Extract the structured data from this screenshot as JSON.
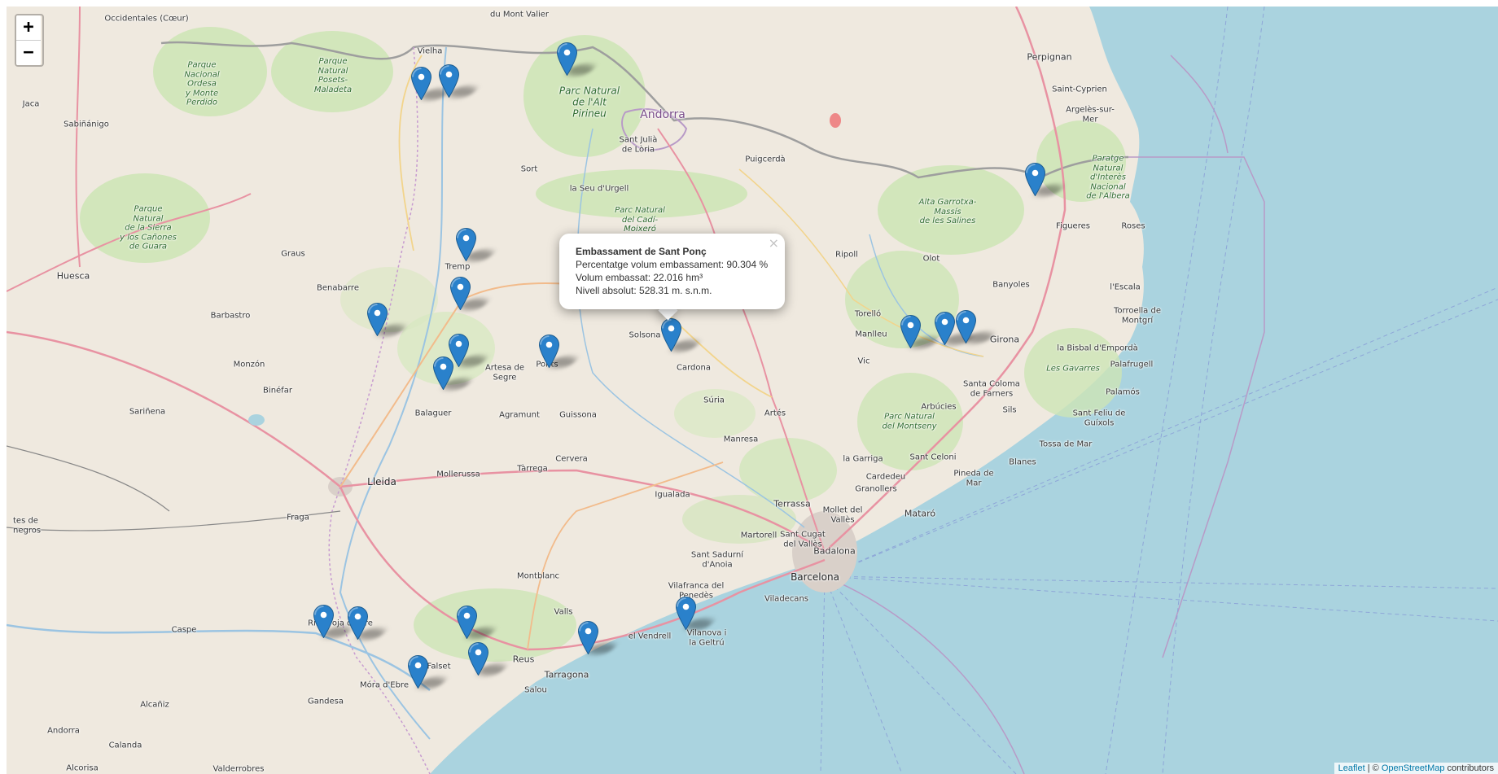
{
  "zoom": {
    "in_label": "+",
    "out_label": "−"
  },
  "popup": {
    "title": "Embassament de Sant Ponç",
    "line1": "Percentatge volum embassament: 90.304 %",
    "line2": "Volum embassat: 22.016 hm³",
    "line3": "Nivell absolut: 528.31 m. s.n.m.",
    "close": "×"
  },
  "attribution": {
    "leaflet": "Leaflet",
    "sep": " | © ",
    "osm": "OpenStreetMap",
    "rest": " contributors"
  },
  "marker_icon": "map-pin-icon",
  "colors": {
    "marker": "#2a81cb",
    "sea": "#aad3df",
    "land": "#efe9df",
    "park": "#cde5b5"
  },
  "places": {
    "vielha": "Vielha",
    "jaca": "Jaca",
    "sabinanigo": "Sabiñánigo",
    "andorra": "Andorra",
    "santjulia": "Sant Julià de Lòria",
    "sort": "Sort",
    "laseu": "la Seu d'Urgell",
    "puigcerda": "Puigcerdà",
    "perpignan": "Perpignan",
    "saintcyprien": "Saint-Cyprien",
    "argeles": "Argelès-sur-Mer",
    "figueres": "Figueres",
    "roses": "Roses",
    "olot": "Olot",
    "banyoles": "Banyoles",
    "lescala": "l'Escala",
    "girona": "Girona",
    "torroella": "Torroella de Montgrí",
    "labisbal": "la Bisbal d'Empordà",
    "palafrugell": "Palafrugell",
    "palamos": "Palamós",
    "santfeliu": "Sant Feliu de Guíxols",
    "tossa": "Tossa de Mar",
    "blanes": "Blanes",
    "pineda": "Pineda de Mar",
    "mataro": "Mataró",
    "badalona": "Badalona",
    "barcelona": "Barcelona",
    "terrassa": "Terrassa",
    "santcugat": "Sant Cugat del Vallès",
    "mollet": "Mollet del Vallès",
    "granollers": "Granollers",
    "cardedeu": "Cardedeu",
    "lagarriga": "la Garriga",
    "santceloni": "Sant Celoni",
    "arbucies": "Arbúcies",
    "santacoloma": "Santa Coloma de Farners",
    "sils": "Sils",
    "vic": "Vic",
    "manlleu": "Manlleu",
    "torello": "Torelló",
    "ripoll": "Ripoll",
    "manresa": "Manresa",
    "artes": "Artés",
    "suria": "Súria",
    "cardona": "Cardona",
    "solsona": "Solsona",
    "ponts": "Ponts",
    "artesa": "Artesa de Segre",
    "tremp": "Tremp",
    "benabarre": "Benabarre",
    "graus": "Graus",
    "huesca": "Huesca",
    "barbastro": "Barbastro",
    "monzon": "Monzón",
    "binefar": "Binéfar",
    "sarinena": "Sariñena",
    "balaguer": "Balaguer",
    "agramunt": "Agramunt",
    "guissona": "Guissona",
    "cervera": "Cervera",
    "tarrega": "Tàrrega",
    "mollerussa": "Mollerussa",
    "lleida": "Lleida",
    "fraga": "Fraga",
    "igualada": "Igualada",
    "martorell": "Martorell",
    "santsadurni": "Sant Sadurní d'Anoia",
    "vilafranca": "Vilafranca del Penedès",
    "viladecans": "Viladecans",
    "vilanova": "Vilanova i la Geltrú",
    "elvendrell": "el Vendrell",
    "valls": "Valls",
    "montblanc": "Montblanc",
    "reus": "Reus",
    "tarragona": "Tarragona",
    "salou": "Salou",
    "falset": "Falset",
    "mora": "Móra d'Ebre",
    "gandesa": "Gandesa",
    "ribaroja": "Riba-roja d'Ebre",
    "caspe": "Caspe",
    "alcaniz": "Alcañiz",
    "andorra_es": "Andorra",
    "calanda": "Calanda",
    "alcorisa": "Alcorisa",
    "valderrobres": "Valderrobres",
    "monegros": "tes de\nnegros",
    "dumont": "du Mont\nValier",
    "occidentales": "Occidentales\n(Cœur)"
  },
  "parks": {
    "ordesa": "Parque\nNacional\nOrdesa\ny Monte\nPerdido",
    "posets": "Parque\nNatural\nPosets-\nMaladeta",
    "altpirineu": "Parc Natural\nde l'Alt\nPirineu",
    "cadi": "Parc Natural\ndel Cadí-\nMoixeró",
    "guara": "Parque\nNatural\nde la Sierra\ny los Cañones\nde Guara",
    "garrotxa": "Alta Garrotxa-\nMassís\nde les Salines",
    "albera": "Paratge\nNatural\nd'Interès\nNacional\nde l'Albera",
    "gavarres": "Les Gavarres",
    "montseny": "Parc Natural\ndel Montseny"
  }
}
